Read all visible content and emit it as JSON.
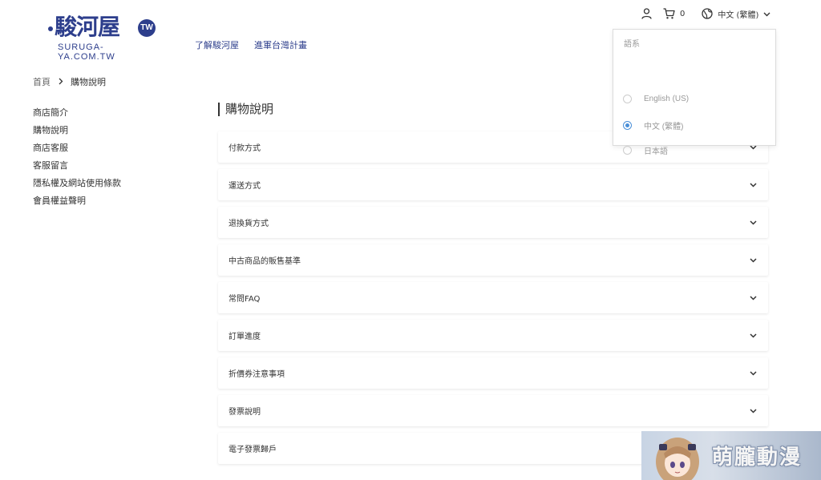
{
  "brand": {
    "logo_text": "駿河屋",
    "logo_badge": "TW",
    "domain": "SURUGA-YA.COM.TW",
    "accent_color": "#2d3e8c"
  },
  "top_nav": [
    {
      "label": "了解駿河屋"
    },
    {
      "label": "進軍台灣計畫"
    }
  ],
  "header": {
    "user_icon": "user-icon",
    "cart_icon": "cart-icon",
    "cart_count": "0",
    "language_icon": "globe-icon",
    "current_language": "中文 (繁體)"
  },
  "language_menu": {
    "title": "語系",
    "options": [
      {
        "label": "English (US)",
        "selected": false
      },
      {
        "label": "中文 (繁體)",
        "selected": true
      },
      {
        "label": "日本語",
        "selected": false
      }
    ]
  },
  "breadcrumb": {
    "home": "首頁",
    "current": "購物說明"
  },
  "sidebar": {
    "items": [
      {
        "label": "商店簡介"
      },
      {
        "label": "購物說明"
      },
      {
        "label": "商店客服"
      },
      {
        "label": "客服留言"
      },
      {
        "label": "隱私權及網站使用條款"
      },
      {
        "label": "會員權益聲明"
      }
    ]
  },
  "main": {
    "title": "購物說明",
    "sections": [
      {
        "label": "付款方式"
      },
      {
        "label": "運送方式"
      },
      {
        "label": "退換貨方式"
      },
      {
        "label": "中古商品的販售基準"
      },
      {
        "label": "常問FAQ"
      },
      {
        "label": "訂單進度"
      },
      {
        "label": "折價券注意事項"
      },
      {
        "label": "發票說明"
      },
      {
        "label": "電子發票歸戶"
      }
    ]
  },
  "promo_banner": {
    "text": "萌朧動漫"
  }
}
